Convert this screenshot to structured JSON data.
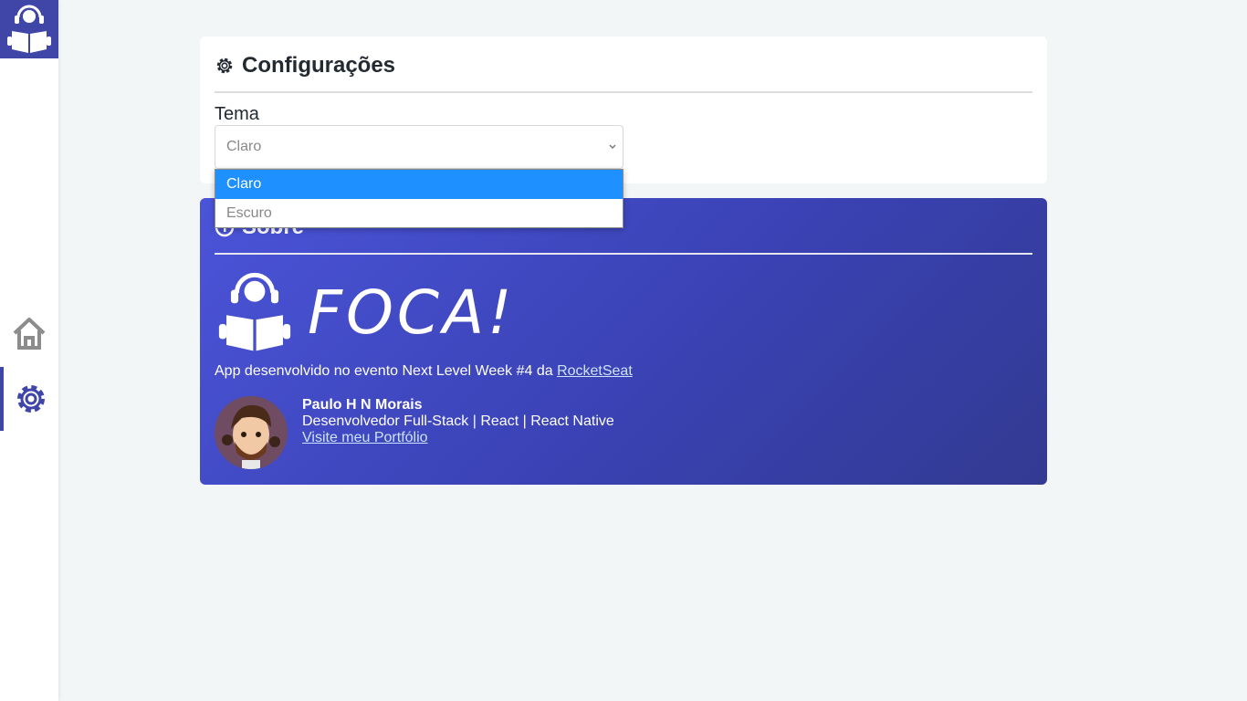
{
  "sidebar": {
    "logo_icon": "book-reader-icon",
    "items": [
      {
        "icon": "home-icon",
        "active": false
      },
      {
        "icon": "gear-icon",
        "active": true
      }
    ]
  },
  "config": {
    "title": "Configurações",
    "icon": "gear-icon",
    "theme_label": "Tema",
    "theme_value": "Claro",
    "theme_options": [
      "Claro",
      "Escuro"
    ]
  },
  "about": {
    "title": "Sobre",
    "brand": "FOCA!",
    "desc_prefix": "App desenvolvido no evento Next Level Week #4 da ",
    "desc_link": "RocketSeat",
    "author_name": "Paulo H N Morais",
    "author_role": "Desenvolvedor Full-Stack | React | React Native",
    "portfolio_link": "Visite meu Portfólio"
  },
  "colors": {
    "accent": "#3f46a8",
    "option_highlight": "#1e90ff",
    "background": "#f2f6f6"
  }
}
